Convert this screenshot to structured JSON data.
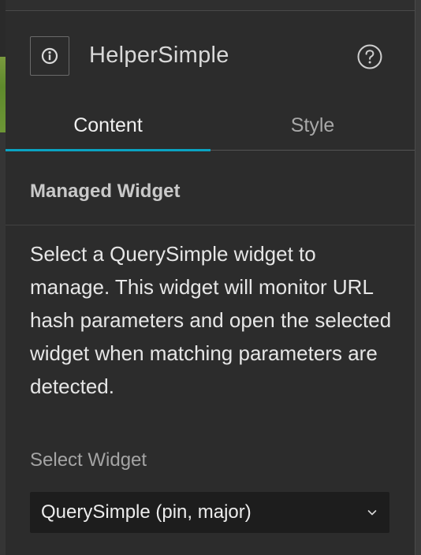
{
  "header": {
    "title": "HelperSimple",
    "info_icon": "info-icon",
    "help_icon": "help-icon"
  },
  "tabs": [
    {
      "label": "Content",
      "active": true
    },
    {
      "label": "Style",
      "active": false
    }
  ],
  "section": {
    "title": "Managed Widget",
    "description": "Select a QuerySimple widget to manage. This widget will monitor URL hash parameters and open the selected widget when matching parameters are detected."
  },
  "select": {
    "label": "Select Widget",
    "value": "QuerySimple (pin, major)",
    "chevron_icon": "chevron-down-icon"
  },
  "colors": {
    "accent": "#0aa3c2",
    "panel_bg": "#2c2c2c",
    "select_bg": "#1d1d1d"
  }
}
